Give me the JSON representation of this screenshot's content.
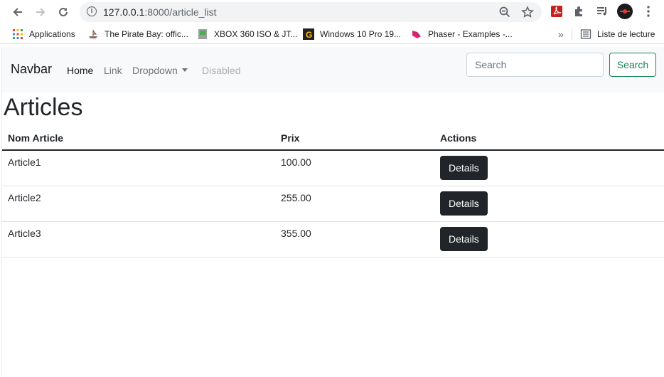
{
  "browser": {
    "url_host": "127.0.0.1",
    "url_path": ":8000/article_list",
    "bookmarks": [
      {
        "label": "Applications"
      },
      {
        "label": "The Pirate Bay: offic..."
      },
      {
        "label": "XBOX 360 ISO & JT..."
      },
      {
        "label": "Windows 10 Pro 19..."
      },
      {
        "label": "Phaser - Examples -..."
      }
    ],
    "overflow_label": "»",
    "reading_list_label": "Liste de lecture"
  },
  "navbar": {
    "brand": "Navbar",
    "links": [
      {
        "label": "Home",
        "state": "active"
      },
      {
        "label": "Link",
        "state": "normal"
      },
      {
        "label": "Dropdown",
        "state": "dropdown"
      },
      {
        "label": "Disabled",
        "state": "disabled"
      }
    ],
    "search_placeholder": "Search",
    "search_button": "Search"
  },
  "main": {
    "title": "Articles",
    "columns": [
      "Nom Article",
      "Prix",
      "Actions"
    ],
    "rows": [
      {
        "name": "Article1",
        "price": "100.00",
        "action": "Details"
      },
      {
        "name": "Article2",
        "price": "255.00",
        "action": "Details"
      },
      {
        "name": "Article3",
        "price": "355.00",
        "action": "Details"
      }
    ]
  },
  "colors": {
    "success": "#198754",
    "dark_button": "#212529",
    "navbar_bg": "#f8f9fa"
  }
}
